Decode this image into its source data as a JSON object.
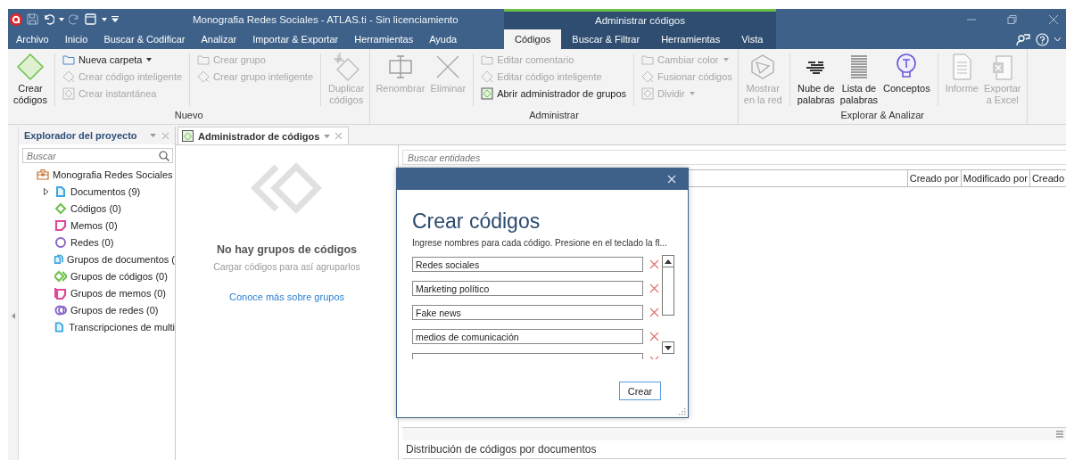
{
  "window": {
    "title": "Monografia Redes Sociales - ATLAS.ti - Sin licenciamiento",
    "context_title": "Administrar códigos"
  },
  "menu_tabs": [
    {
      "label": "Archivo",
      "selected": false,
      "kind": "file"
    },
    {
      "label": "Inicio",
      "selected": false,
      "kind": "main"
    },
    {
      "label": "Buscar & Codificar",
      "selected": false,
      "kind": "main"
    },
    {
      "label": "Analizar",
      "selected": false,
      "kind": "main"
    },
    {
      "label": "Importar & Exportar",
      "selected": false,
      "kind": "main"
    },
    {
      "label": "Herramientas",
      "selected": false,
      "kind": "main"
    },
    {
      "label": "Ayuda",
      "selected": false,
      "kind": "main"
    },
    {
      "label": "Códigos",
      "selected": true,
      "kind": "context"
    },
    {
      "label": "Buscar & Filtrar",
      "selected": false,
      "kind": "context"
    },
    {
      "label": "Herramientas",
      "selected": false,
      "kind": "context"
    },
    {
      "label": "Vista",
      "selected": false,
      "kind": "context"
    }
  ],
  "ribbon": {
    "groups": [
      {
        "label": "Nuevo",
        "sections": [
          {
            "columns": [
              {
                "kind": "large",
                "label_lines": [
                  "Crear",
                  "códigos"
                ],
                "disabled": false
              }
            ]
          },
          {
            "columns": [
              {
                "kind": "stack",
                "items": [
                  {
                    "label": "Nueva carpeta",
                    "disabled": false,
                    "dropdown": true
                  },
                  {
                    "label": "Crear código inteligente",
                    "disabled": true,
                    "dropdown": false
                  },
                  {
                    "label": "Crear instantánea",
                    "disabled": true,
                    "dropdown": false
                  }
                ]
              }
            ]
          },
          {
            "columns": [
              {
                "kind": "stack",
                "items": [
                  {
                    "label": "Crear grupo",
                    "disabled": true,
                    "dropdown": false
                  },
                  {
                    "label": "Crear grupo inteligente",
                    "disabled": true,
                    "dropdown": false
                  }
                ]
              }
            ]
          },
          {
            "columns": [
              {
                "kind": "large",
                "label_lines": [
                  "Duplicar",
                  "códigos"
                ],
                "disabled": true
              }
            ]
          }
        ]
      },
      {
        "label": "Administrar",
        "sections": [
          {
            "columns": [
              {
                "kind": "large",
                "label_lines": [
                  "Renombrar"
                ],
                "disabled": true
              },
              {
                "kind": "large",
                "label_lines": [
                  "Eliminar"
                ],
                "disabled": true
              }
            ]
          },
          {
            "columns": [
              {
                "kind": "stack",
                "items": [
                  {
                    "label": "Editar comentario",
                    "disabled": true,
                    "dropdown": false
                  },
                  {
                    "label": "Editar código inteligente",
                    "disabled": true,
                    "dropdown": false
                  },
                  {
                    "label": "Abrir administrador de grupos",
                    "disabled": false,
                    "dropdown": false
                  }
                ]
              }
            ]
          },
          {
            "columns": [
              {
                "kind": "stack",
                "items": [
                  {
                    "label": "Cambiar color",
                    "disabled": true,
                    "dropdown": true
                  },
                  {
                    "label": "Fusionar códigos",
                    "disabled": true,
                    "dropdown": false
                  },
                  {
                    "label": "Dividir",
                    "disabled": true,
                    "dropdown": true
                  }
                ]
              }
            ]
          }
        ]
      },
      {
        "label": "Explorar & Analizar",
        "sections": [
          {
            "columns": [
              {
                "kind": "large",
                "label_lines": [
                  "Mostrar",
                  "en la red"
                ],
                "disabled": true
              }
            ]
          },
          {
            "columns": [
              {
                "kind": "large",
                "label_lines": [
                  "Nube de",
                  "palabras"
                ],
                "disabled": false
              },
              {
                "kind": "large",
                "label_lines": [
                  "Lista de",
                  "palabras"
                ],
                "disabled": false
              },
              {
                "kind": "large",
                "label_lines": [
                  "Conceptos"
                ],
                "disabled": false
              }
            ]
          },
          {
            "columns": [
              {
                "kind": "large",
                "label_lines": [
                  "Informe"
                ],
                "disabled": true
              },
              {
                "kind": "large",
                "label_lines": [
                  "Exportar",
                  "a Excel"
                ],
                "disabled": true
              }
            ]
          }
        ]
      }
    ]
  },
  "explorer": {
    "title": "Explorador del proyecto",
    "search": {
      "placeholder": "Buscar"
    },
    "root": {
      "label": "Monografia Redes Sociales",
      "color": "#c8702a",
      "children": [
        {
          "label": "Documentos (9)",
          "color": "#3aa7e0",
          "expanded": false
        },
        {
          "label": "Códigos (0)",
          "color": "#6cc04a"
        },
        {
          "label": "Memos (0)",
          "color": "#e0489a"
        },
        {
          "label": "Redes (0)",
          "color": "#8a66c8"
        },
        {
          "label": "Grupos de documentos (",
          "color": "#3aa7e0"
        },
        {
          "label": "Grupos de códigos (0)",
          "color": "#6cc04a"
        },
        {
          "label": "Grupos de memos (0)",
          "color": "#e0489a"
        },
        {
          "label": "Grupos de redes (0)",
          "color": "#8a66c8"
        },
        {
          "label": "Transcripciones de multi",
          "color": "#3aa7e0"
        }
      ]
    }
  },
  "manager": {
    "tab": {
      "label": "Administrador de códigos",
      "selected": true
    },
    "empty_state": {
      "title": "No hay grupos de códigos",
      "subtitle": "Cargar códigos para así agruparlos",
      "link": "Conoce más sobre grupos"
    },
    "search": {
      "placeholder": "Buscar entidades"
    },
    "columns": [
      "Creado por",
      "Modificado por",
      "Creado"
    ],
    "bottom_panel": {
      "title": "Distribución de códigos por documentos"
    }
  },
  "dialog": {
    "title": "Crear códigos",
    "instruction": "Ingrese nombres para cada código. Presione en el teclado la fl...",
    "fields": [
      {
        "value": "Redes sociales"
      },
      {
        "value": "Marketing político"
      },
      {
        "value": "Fake news"
      },
      {
        "value": "medios de comunicación"
      }
    ],
    "button": "Crear"
  }
}
